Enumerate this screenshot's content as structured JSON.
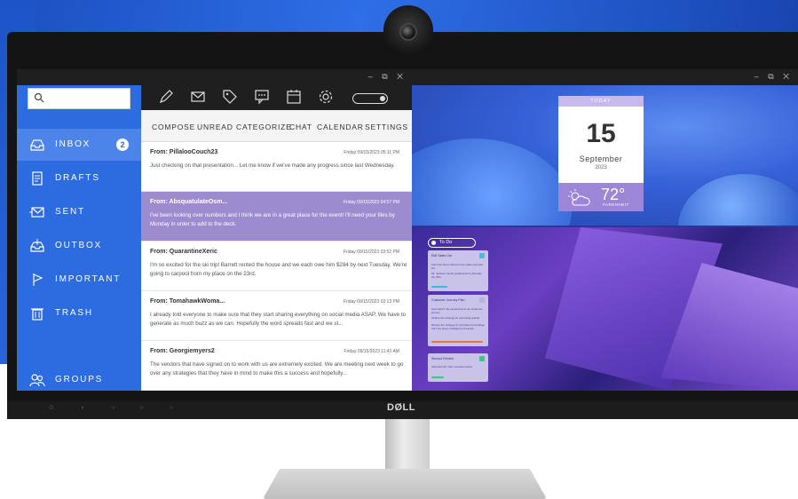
{
  "mail": {
    "window_controls": "– ⧉ ✕",
    "search": {
      "placeholder": ""
    },
    "nav": [
      {
        "label": "INBOX",
        "icon": "inbox-icon",
        "badge": "2",
        "active": true
      },
      {
        "label": "DRAFTS",
        "icon": "drafts-icon"
      },
      {
        "label": "SENT",
        "icon": "sent-icon"
      },
      {
        "label": "OUTBOX",
        "icon": "outbox-icon"
      },
      {
        "label": "IMPORTANT",
        "icon": "flag-icon"
      },
      {
        "label": "TRASH",
        "icon": "trash-icon"
      },
      {
        "label": "GROUPS",
        "icon": "groups-icon"
      }
    ],
    "toolbar_icons": [
      "pencil-icon",
      "envelope-icon",
      "tag-icon",
      "chat-icon",
      "calendar-icon",
      "settings-gear-icon"
    ],
    "menu": [
      "COMPOSE",
      "UNREAD",
      "CATEGORIZE",
      "CHAT",
      "CALENDAR",
      "SETTINGS"
    ],
    "messages": [
      {
        "from": "From: PillalooCouch23",
        "date": "Friday 09/15/2023 05:11 PM",
        "body": "Just checking on that presentation... Let me know if we've made any progress since last Wednesday."
      },
      {
        "from": "From: AbsquatulateOsm...",
        "date": "Friday 09/15/2023 04:57 PM",
        "selected": true,
        "body": "I've been looking over numbers and I think we are in a great place for the event! I'll need your files by Monday in order to add to the deck."
      },
      {
        "from": "From: QuarantineXeric",
        "date": "Friday 09/15/2023 03:52 PM",
        "body": "I'm so excited for the ski trip! Barrett rented the house and we each owe him $284 by next Tuesday. We're going to carpool from my place on the 23rd."
      },
      {
        "from": "From: TomahawkWoma...",
        "date": "Friday 09/15/2023 02:13 PM",
        "body": "I already told everyone to make sure that they start sharing everything on social media ASAP. We have to generate as much buzz as we can. Hopefully the word spreads fast and we st..."
      },
      {
        "from": "From: Georgiemyers2",
        "date": "Friday 09/15/2023 11:41 AM",
        "body": "The vendors that have signed on to work with us are extremely excited. We are meeting next week to go over any strategies that they have in mind to make this a success and hopefully..."
      }
    ]
  },
  "widgets": {
    "window_controls": "– ⧉ ✕",
    "calendar": {
      "header": "TODAY",
      "day": "15",
      "month": "September",
      "year": "2023"
    },
    "weather": {
      "temp": "72°",
      "unit": "FARENHEIT",
      "icon": "partly-cloudy-icon"
    },
    "todo": {
      "title": "To Do",
      "cards": [
        {
          "title": "Edit Sales List",
          "lines": [
            "Add new client names to the sales overview list",
            "Mr. Jackson needs updated list by Monday the 25th"
          ],
          "bar_color": "#3fb6e0",
          "check_color": "#4fb6e6"
        },
        {
          "title": "Customer Journey Plan",
          "lines": [
            "Summarize the experience of our customer journey",
            "Outline the strategy for upcoming quarter",
            "Review the strategy for Q4 based on findings from the buyer intelligence Presentn"
          ],
          "bar_color": "#e2793a",
          "check_color": "#b8b0e0"
        },
        {
          "title": "Second Review",
          "lines": [
            "Schedule Mr. Cal's renewal review"
          ],
          "bar_color": "#45c08a",
          "check_color": "#45c08a"
        }
      ]
    }
  },
  "device": {
    "brand": "DØLL",
    "chin_icons": "⊙ ◗ ◃ ▹ ▹"
  }
}
